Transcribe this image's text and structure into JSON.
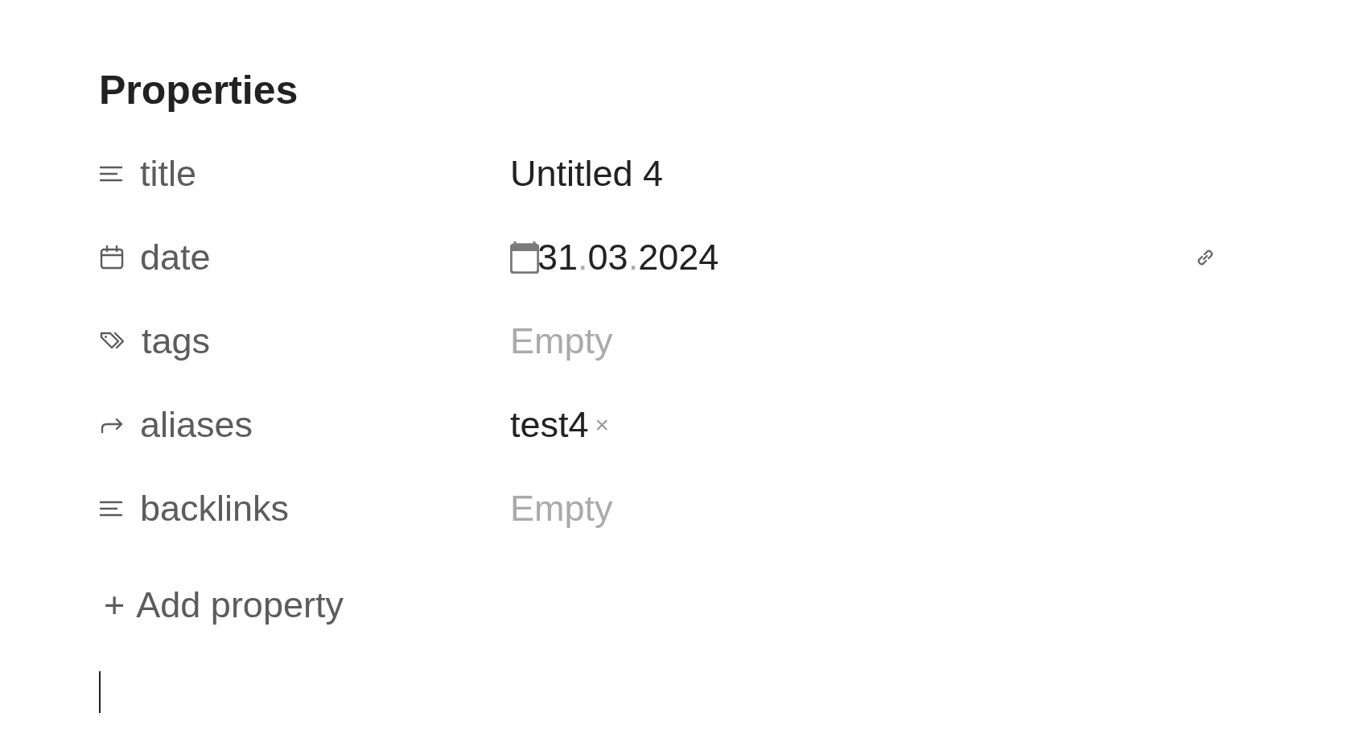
{
  "heading": "Properties",
  "properties": [
    {
      "kind": "text",
      "name": "title",
      "value": "Untitled 4"
    },
    {
      "kind": "date",
      "name": "date",
      "date_parts": [
        {
          "kind": "digits",
          "text": "31"
        },
        {
          "kind": "separator",
          "text": "."
        },
        {
          "kind": "digits",
          "text": "03"
        },
        {
          "kind": "separator",
          "text": "."
        },
        {
          "kind": "digits",
          "text": "2024"
        }
      ]
    },
    {
      "kind": "tags",
      "name": "tags",
      "placeholder": "Empty"
    },
    {
      "kind": "aliases",
      "name": "aliases",
      "pills": [
        {
          "text": "test4",
          "remove": "×"
        }
      ]
    },
    {
      "kind": "text",
      "name": "backlinks",
      "placeholder": "Empty"
    }
  ],
  "add_property": {
    "icon": "+",
    "label": "Add property"
  }
}
